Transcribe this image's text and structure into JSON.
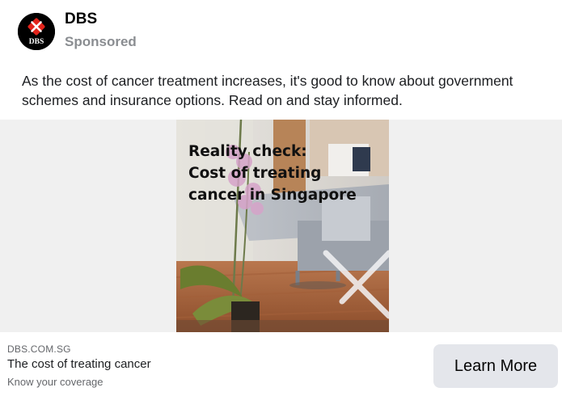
{
  "post": {
    "page_name": "DBS",
    "sponsored_label": "Sponsored",
    "avatar_icon": "dbs-logo-icon",
    "avatar_text": "DBS",
    "text": "As the cost of cancer treatment increases, it's good to know about government schemes and insurance options. Read on and stay informed."
  },
  "media": {
    "headline_lines": [
      "Reality check:",
      "Cost of treating",
      "cancer in Singapore"
    ],
    "image_icon": "office-orchid-photo"
  },
  "link": {
    "domain": "DBS.COM.SG",
    "title": "The cost of treating cancer",
    "description": "Know your coverage",
    "cta_label": "Learn More"
  },
  "colors": {
    "brand_red": "#e2231a",
    "muted_text": "#65676b",
    "cta_background": "#e4e6eb"
  }
}
